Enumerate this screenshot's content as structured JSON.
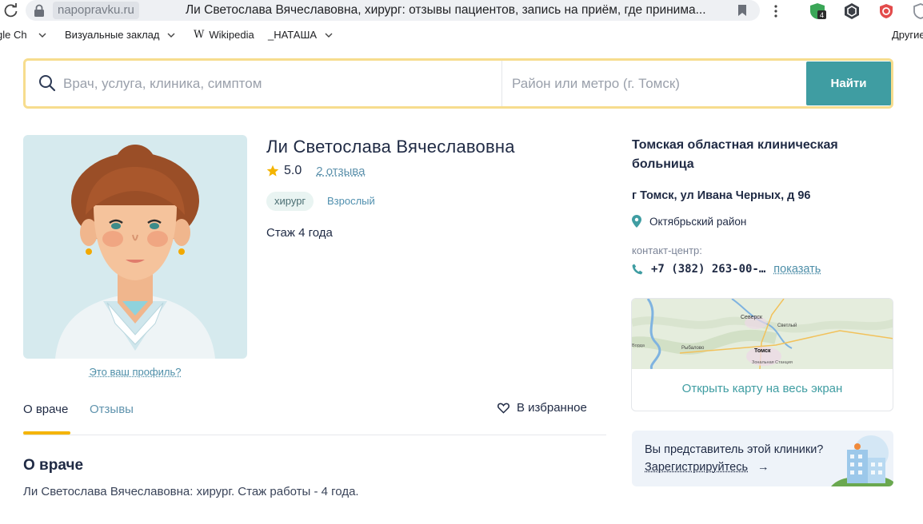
{
  "browser": {
    "domain": "napopravku.ru",
    "tab_title": "Ли Светослава Вячеславовна, хирург: отзывы пациентов, запись на приём, где принима...",
    "extension_badge": "4",
    "bookmarks": [
      {
        "label": "gle Ch",
        "has_chevron": true
      },
      {
        "label": "Визуальные заклад",
        "has_chevron": true
      },
      {
        "label": "Wikipedia",
        "has_chevron": false,
        "logo": "W"
      },
      {
        "label": "_НАТАША",
        "has_chevron": true
      }
    ],
    "other_bookmarks": "Другие"
  },
  "search": {
    "query_placeholder": "Врач, услуга, клиника, симптом",
    "location_placeholder": "Район или метро (г. Томск)",
    "button_label": "Найти"
  },
  "doctor": {
    "name": "Ли Светослава Вячеславовна",
    "rating": "5.0",
    "reviews_link": "2 отзыва",
    "tags": [
      "хирург",
      "Взрослый"
    ],
    "experience": "Стаж 4 года",
    "profile_link": "Это ваш профиль?"
  },
  "tabs": {
    "items": [
      "О враче",
      "Отзывы"
    ],
    "active": "О враче",
    "favorite_label": "В избранное"
  },
  "about": {
    "title": "О враче",
    "text": "Ли Светослава Вячеславовна: хирург. Стаж работы - 4 года."
  },
  "clinic": {
    "name": "Томская областная клиническая больница",
    "address": "г Томск, ул Ивана Черных, д 96",
    "district": "Октябрьский район",
    "contact_label": "контакт-центр:",
    "phone": "+7 (382) 263-00-…",
    "show_phone": "показать",
    "map_labels": [
      "Северск",
      "Светлый",
      "Рыбалово",
      "Томск",
      "Зональная Станция",
      "Ворда"
    ],
    "map_link": "Открыть карту на весь экран"
  },
  "representative": {
    "question": "Вы представитель этой клиники?",
    "register_link": "Зарегистрируйтесь",
    "arrow": "→"
  },
  "colors": {
    "accent_teal": "#3f9da2",
    "search_border": "#f7dd8e",
    "tab_underline": "#f4b400",
    "star": "#f4b400",
    "link": "#4d8ea8"
  }
}
